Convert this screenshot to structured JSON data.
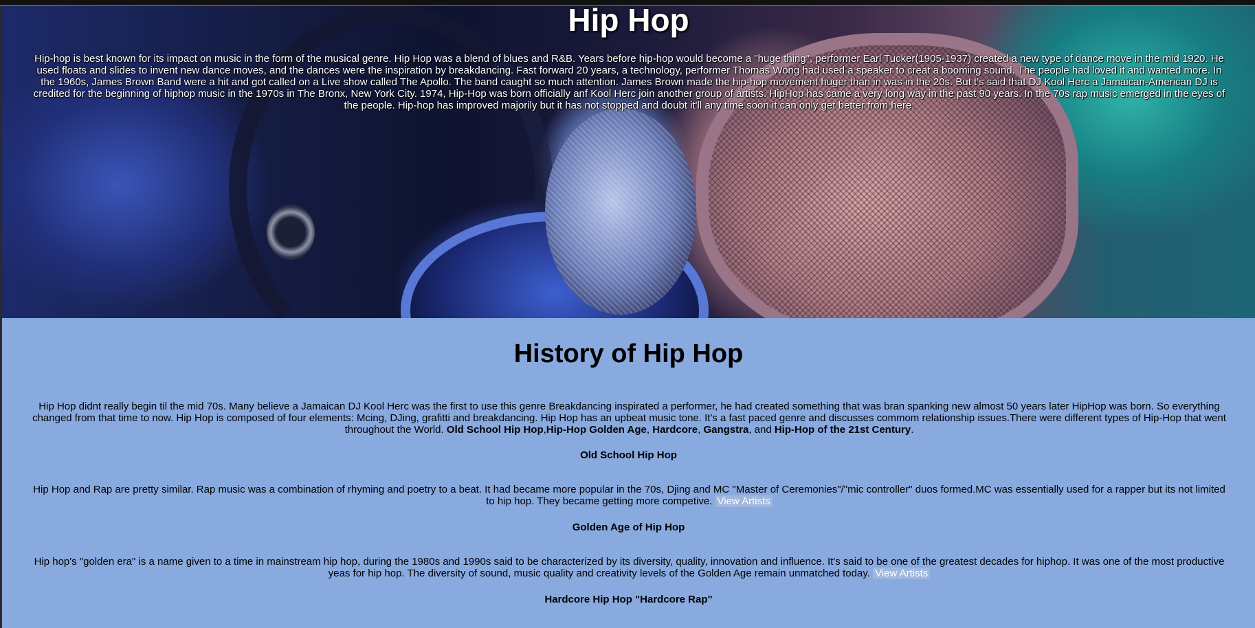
{
  "hero": {
    "title": "Hip Hop",
    "text": "Hip-hop is best known for its impact on music in the form of the musical genre. Hip Hop was a blend of blues and R&B. Years before hip-hop would become a \"huge thing\", performer Earl Tucker(1905-1937) created a new type of dance move in the mid 1920. He used floats and slides to invent new dance moves, and the dances were the inspiration by breakdancing. Fast forward 20 years, a technology, performer Thomas Wong had used a speaker to creat a booming sound. The people had loved it and wanted more. In the 1960s, James Brown Band were a hit and got called on a Live show called The Apollo. The band caught so much attention. James Brown made the hip-hop movement huger than in was in the 20s. But t's said that DJ Kool Herc a Jamaican-American DJ is credited for the beginning of hiphop music in the 1970s in The Bronx, New York City. 1974, Hip-Hop was born officially anf Kool Herc join another group of artists. HipHop has came a very long way in the past 90 years. In the 70s rap music emerged in the eyes of the people. Hip-hop has improved majorily but it has not stopped and doubt it'll any time soon it can only get better from here."
  },
  "history": {
    "heading": "History of Hip Hop",
    "intro_text": "Hip Hop didnt really begin til the mid 70s. Many believe a Jamaican DJ Kool Herc was the first to use this genre Breakdancing inspirated a performer, he had created something that was bran spanking new almost 50 years later HipHop was born. So everything changed from that time to now. Hip Hop is composed of four elements: Mcing, DJing, grafitti and breakdancing. Hip Hop has an upbeat music tone. It's a fast paced genre and discusses commom relationship issues.There were different types of Hip-Hop that went throughout the World. ",
    "eras": {
      "old_school": "Old School Hip Hop",
      "golden_age": "Hip-Hop Golden Age",
      "hardcore": "Hardcore",
      "gangstra": "Gangstra",
      "century": "Hip-Hop of the 21st Century"
    },
    "sep_comma": ",",
    "sep_comma_space": ", ",
    "sep_and": ", and ",
    "sep_period": "."
  },
  "sections": {
    "old_school": {
      "title": "Old School Hip Hop",
      "text": "Hip Hop and Rap are pretty similar. Rap music was a combination of rhyming and poetry to a beat. It had became more popular in the 70s, Djing and MC \"Master of Ceremonies\"/\"mic controller\" duos formed.MC was essentially used for a rapper but its not limited to hip hop. They became getting more competive. ",
      "link": "View Artists"
    },
    "golden_age": {
      "title": "Golden Age of Hip Hop",
      "text": "Hip hop's \"golden era\" is a name given to a time in mainstream hip hop, during the 1980s and 1990s said to be characterized by its diversity, quality, innovation and influence. It's said to be one of the greatest decades for hiphop. It was one of the most productive yeas for hip hop. The diversity of sound, music quality and creativity levels of the Golden Age remain unmatched today. ",
      "link": "View Artists"
    },
    "hardcore": {
      "title": "Hardcore Hip Hop \"Hardcore Rap\""
    }
  },
  "colors": {
    "section_background": "#88aadf",
    "hero_text": "#ffffff",
    "link_background": "#9fb6dd"
  }
}
